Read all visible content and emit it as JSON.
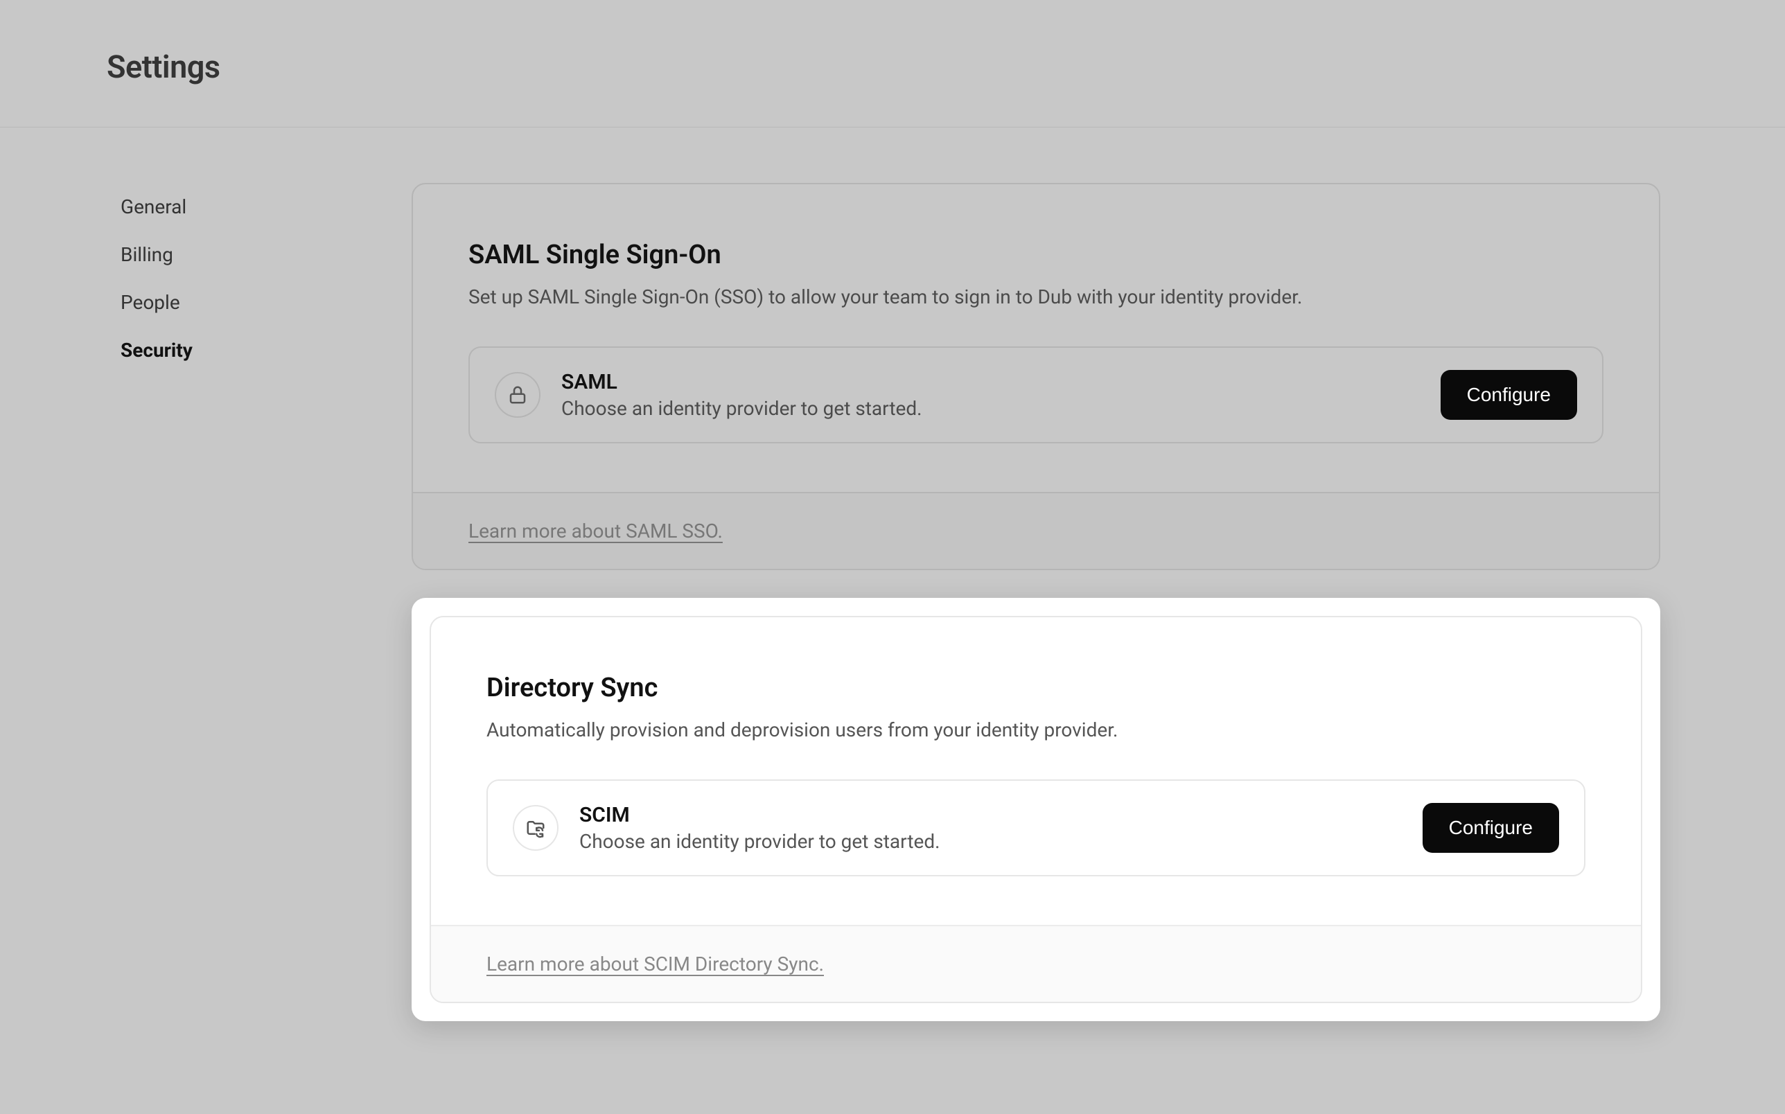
{
  "page_title": "Settings",
  "sidebar": {
    "items": [
      {
        "label": "General"
      },
      {
        "label": "Billing"
      },
      {
        "label": "People"
      },
      {
        "label": "Security"
      }
    ],
    "active_index": 3
  },
  "saml": {
    "title": "SAML Single Sign-On",
    "description": "Set up SAML Single Sign-On (SSO) to allow your team to sign in to Dub with your identity provider.",
    "row_title": "SAML",
    "row_sub": "Choose an identity provider to get started.",
    "button": "Configure",
    "footer_link": "Learn more about SAML SSO."
  },
  "directory_sync": {
    "title": "Directory Sync",
    "description": "Automatically provision and deprovision users from your identity provider.",
    "row_title": "SCIM",
    "row_sub": "Choose an identity provider to get started.",
    "button": "Configure",
    "footer_link": "Learn more about SCIM Directory Sync."
  }
}
